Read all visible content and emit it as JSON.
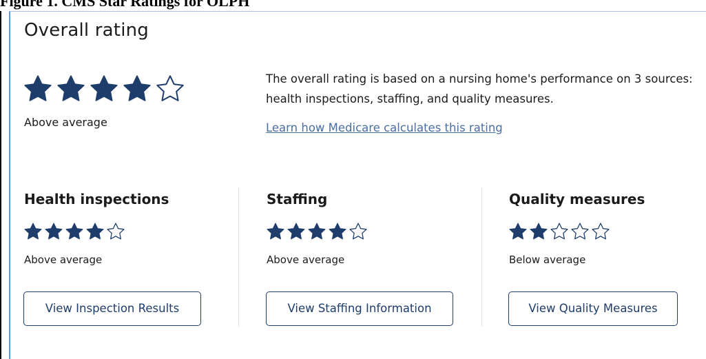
{
  "figure_caption": "Figure 1.  CMS Star Ratings for OLPH",
  "overall": {
    "title": "Overall rating",
    "stars_filled": 4,
    "stars_total": 5,
    "label": "Above average",
    "description": "The overall rating is based on a nursing home's performance on 3 sources: health inspections, staffing, and quality measures.",
    "link": "Learn how Medicare calculates this rating"
  },
  "categories": [
    {
      "title": "Health inspections",
      "stars_filled": 4,
      "stars_total": 5,
      "label": "Above average",
      "button": "View Inspection Results"
    },
    {
      "title": "Staffing",
      "stars_filled": 4,
      "stars_total": 5,
      "label": "Above average",
      "button": "View Staffing Information"
    },
    {
      "title": "Quality measures",
      "stars_filled": 2,
      "stars_total": 5,
      "label": "Below average",
      "button": "View Quality Measures"
    }
  ],
  "colors": {
    "star": "#1f3d6b",
    "link": "#4a6fa5",
    "panel_border": "#5b9bd5"
  },
  "icons": {
    "filled": "star-filled-icon",
    "empty": "star-outline-icon"
  }
}
